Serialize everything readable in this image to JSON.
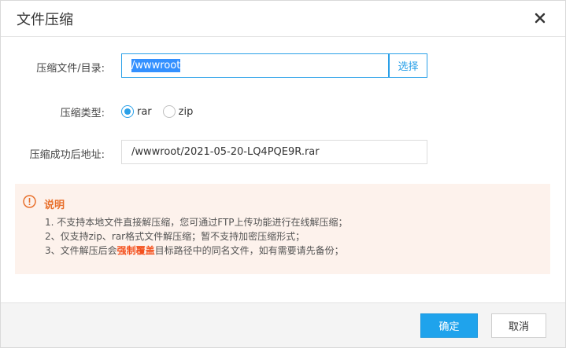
{
  "dialog": {
    "title": "文件压缩",
    "close_icon": "close-icon"
  },
  "form": {
    "source_label": "压缩文件/目录:",
    "source_value": "/wwwroot",
    "choose_label": "选择",
    "type_label": "压缩类型:",
    "type_options": [
      {
        "label": "rar",
        "checked": true
      },
      {
        "label": "zip",
        "checked": false
      }
    ],
    "dest_label": "压缩成功后地址:",
    "dest_value": "/wwwroot/2021-05-20-LQ4PQE9R.rar"
  },
  "notice": {
    "icon": "alert-circle-icon",
    "title": "说明",
    "line1": "1. 不支持本地文件直接解压缩，您可通过FTP上传功能进行在线解压缩；",
    "line2": "2、仅支持zip、rar格式文件解压缩；暂不支持加密压缩形式；",
    "line3_prefix": "3、文件解压后会",
    "line3_highlight": "强制覆盖",
    "line3_suffix": "目标路径中的同名文件，如有需要请先备份；"
  },
  "footer": {
    "ok_label": "确定",
    "cancel_label": "取消"
  },
  "colors": {
    "accent": "#1fa3ec",
    "notice_bg": "#fdf2ec",
    "notice_title": "#e8702c",
    "highlight": "#f4511e"
  }
}
